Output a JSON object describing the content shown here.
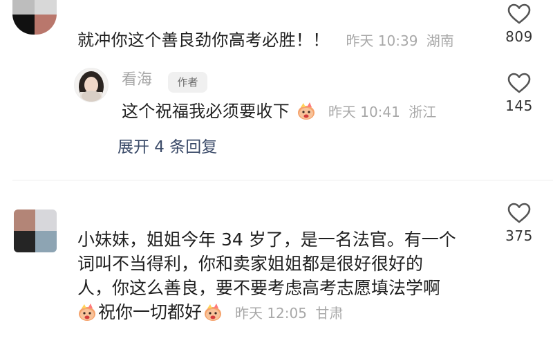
{
  "comments": [
    {
      "text": "就冲你这个善良劲你高考必胜！！",
      "date": "昨天 10:39",
      "location": "湖南",
      "likes": "809"
    },
    {
      "text": "小妹妹，姐姐今年34岁了，是一名法官。有一个词叫不当得利，你和卖家姐姐都是很好很好的人，你这么善良，要不要考虑高考志愿填法学啊",
      "lines": [
        "小妹妹，姐姐今年 34 岁了，是一名法官。有一个",
        "词叫不当得利，你和卖家姐姐都是很好很好的",
        "人，你这么善良，要不要考虑高考志愿填法学啊",
        "祝你一切都好"
      ],
      "date": "昨天 12:05",
      "location": "甘肃",
      "likes": "375",
      "icons": [
        "celebrate-emoji",
        "heart-outline-icon"
      ]
    }
  ],
  "reply": {
    "author": "看海",
    "badge": "作者",
    "text": "这个祝福我必须要收下",
    "date": "昨天 10:41",
    "location": "浙江",
    "likes": "145",
    "icons": [
      "celebrate-emoji",
      "heart-outline-icon"
    ]
  },
  "expand_replies": "展开 4 条回复",
  "colors": {
    "text": "#1f1f1f",
    "meta": "#a8a8a8",
    "link": "#3a4a68",
    "badge_bg": "#f0f0f0"
  }
}
